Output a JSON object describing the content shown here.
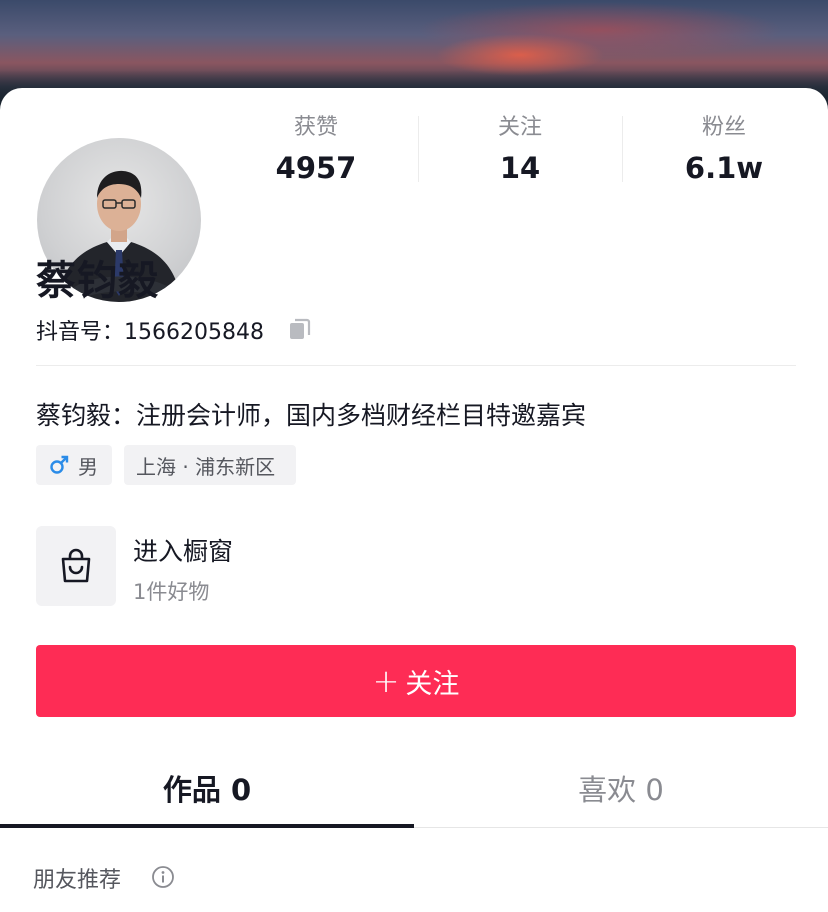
{
  "profile": {
    "name": "蔡钧毅",
    "account_id": "抖音号：1566205848",
    "bio": "蔡钧毅：注册会计师，国内多档财经栏目特邀嘉宾",
    "gender_tag": "男",
    "location_tag": "上海 · 浦东新区"
  },
  "stats": [
    {
      "label": "获赞",
      "value": "4957"
    },
    {
      "label": "关注",
      "value": "14"
    },
    {
      "label": "粉丝",
      "value": "6.1w"
    }
  ],
  "shop": {
    "title": "进入橱窗",
    "subtitle": "1件好物"
  },
  "follow_button": {
    "plus": "+",
    "label": "关注"
  },
  "tabs": [
    {
      "label": "作品 0",
      "active": true
    },
    {
      "label": "喜欢 0",
      "active": false
    }
  ],
  "friends_section": {
    "title": "朋友推荐"
  },
  "icons": {
    "copy": "copy-icon",
    "male": "male-icon",
    "shop": "shopping-bag-icon",
    "info": "info-icon"
  },
  "colors": {
    "accent": "#fe2c55",
    "male_icon": "#2b8ce8",
    "text_primary": "#161823",
    "text_secondary": "#8a8b91"
  }
}
